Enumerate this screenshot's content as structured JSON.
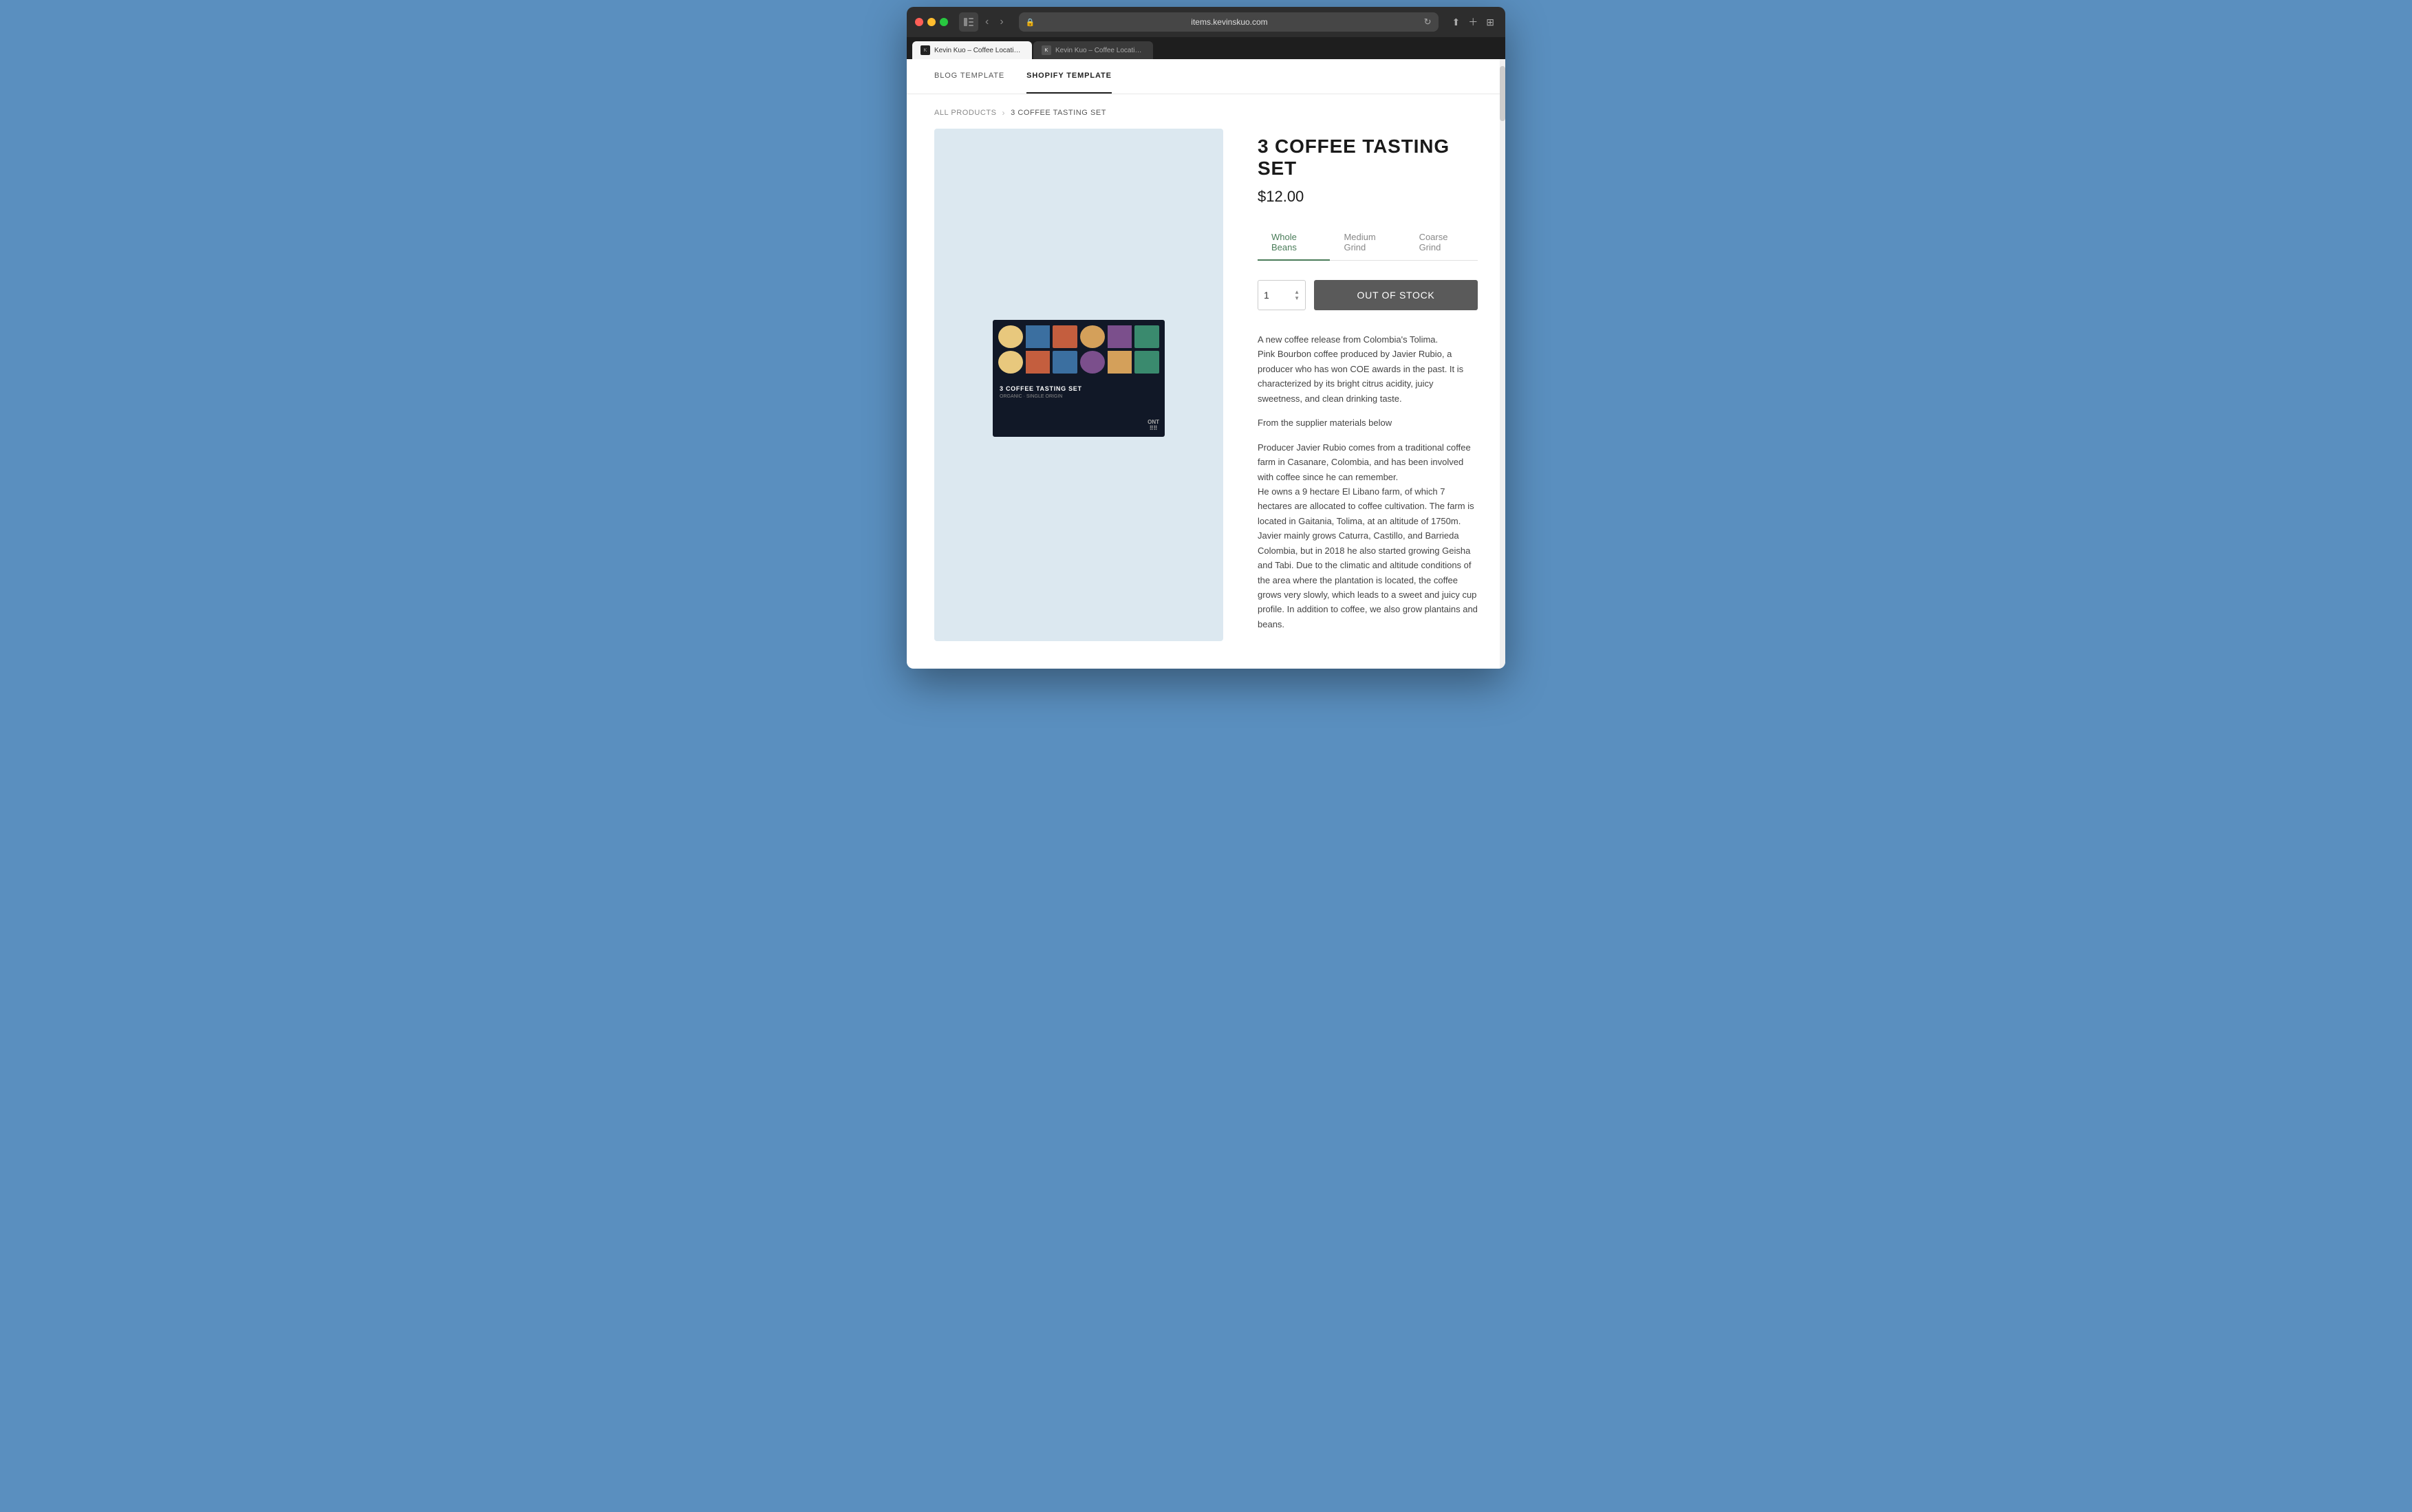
{
  "browser": {
    "url": "items.kevinskuo.com",
    "tab1_label": "Kevin Kuo – Coffee Locations and Items",
    "tab2_label": "Kevin Kuo – Coffee Locations and Items",
    "nav_back": "‹",
    "nav_forward": "›"
  },
  "nav": {
    "items": [
      {
        "id": "blog",
        "label": "BLOG TEMPLATE",
        "active": false
      },
      {
        "id": "shopify",
        "label": "SHOPIFY TEMPLATE",
        "active": true
      }
    ]
  },
  "breadcrumb": {
    "all_products": "ALL PRODUCTS",
    "separator": "›",
    "current": "3 COFFEE TASTING SET"
  },
  "product": {
    "title": "3 COFFEE TASTING SET",
    "price": "$12.00",
    "image_alt": "3 Coffee Tasting Set product box",
    "box_label": "3 COFFEE TASTING SET",
    "grind_tabs": [
      {
        "id": "whole",
        "label": "Whole Beans",
        "active": true
      },
      {
        "id": "medium",
        "label": "Medium Grind",
        "active": false
      },
      {
        "id": "coarse",
        "label": "Coarse Grind",
        "active": false
      }
    ],
    "quantity": "1",
    "out_of_stock_label": "Out of Stock",
    "description_p1": "A new coffee release from Colombia's Tolima.\nPink Bourbon coffee produced by Javier Rubio, a producer who has won COE awards in the past. It is characterized by its bright citrus acidity, juicy sweetness, and clean drinking taste.",
    "description_p2": "From the supplier materials below",
    "description_p3": "Producer Javier Rubio comes from a traditional coffee farm in Casanare, Colombia, and has been involved with coffee since he can remember.\nHe owns a 9 hectare El Libano farm, of which 7 hectares are allocated to coffee cultivation. The farm is located in Gaitania, Tolima, at an altitude of 1750m.\nJavier mainly grows Caturra, Castillo, and Barrieda Colombia, but in 2018 he also started growing Geisha and Tabi. Due to the climatic and altitude conditions of the area where the plantation is located, the coffee grows very slowly, which leads to a sweet and juicy cup profile. In addition to coffee, we also grow plantains and beans."
  },
  "colors": {
    "accent_green": "#4a7c59",
    "out_of_stock_bg": "#5a5a5a",
    "product_bg": "#dce8f0"
  },
  "pattern_colors": [
    "#e8c87d",
    "#3b6fa0",
    "#c45e3e",
    "#d4a05a",
    "#7b4f8c",
    "#3a8a6e",
    "#e8c87d",
    "#c45e3e",
    "#3b6fa0",
    "#7b4f8c",
    "#d4a05a",
    "#3a8a6e",
    "#a03b3b",
    "#e8c87d",
    "#3b6fa0",
    "#3a8a6e",
    "#c45e3e",
    "#7b4f8c",
    "#3b6fa0",
    "#a03b3b",
    "#e8c87d",
    "#c45e3e",
    "#3a8a6e",
    "#d4a05a"
  ]
}
